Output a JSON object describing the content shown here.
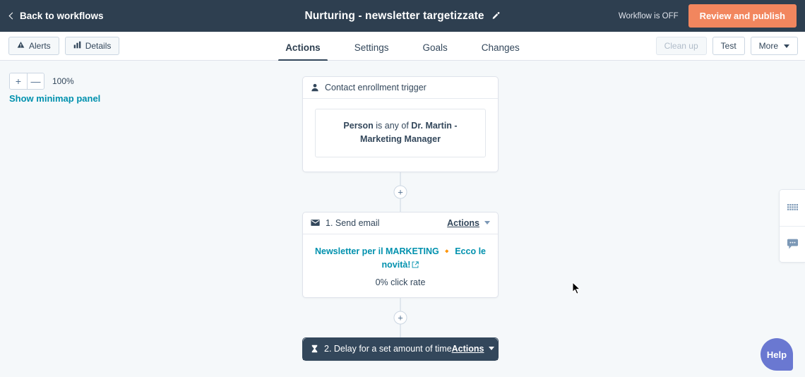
{
  "header": {
    "back_label": "Back to workflows",
    "back_icon": "chevron-left-icon",
    "workflow_title": "Nurturing - newsletter targetizzate",
    "edit_icon": "pencil-icon",
    "workflow_status": "Workflow is OFF",
    "publish_label": "Review and publish",
    "publish_color": "#f2865e",
    "bar_color": "#2e3f50"
  },
  "subnav": {
    "alerts_label": "Alerts",
    "alerts_icon": "warning-triangle-icon",
    "details_label": "Details",
    "details_icon": "bar-chart-icon",
    "tabs": [
      {
        "label": "Actions",
        "active": true
      },
      {
        "label": "Settings",
        "active": false
      },
      {
        "label": "Goals",
        "active": false
      },
      {
        "label": "Changes",
        "active": false
      }
    ],
    "cleanup_label": "Clean up",
    "cleanup_disabled": true,
    "test_label": "Test",
    "more_label": "More"
  },
  "canvas": {
    "zoom_in_label": "+",
    "zoom_out_label": "—",
    "zoom_level": "100%",
    "minimap_link": "Show minimap panel",
    "link_color": "#0091ae"
  },
  "flow": {
    "trigger": {
      "icon": "contact-person-icon",
      "title": "Contact enrollment trigger",
      "filter_prefix": "Person",
      "filter_operator": " is any of ",
      "filter_value": "Dr. Martin - Marketing Manager"
    },
    "email_step": {
      "icon": "envelope-icon",
      "title": "1. Send email",
      "actions_label": "Actions",
      "subject": "Newsletter per il MARKETING 🔸 Ecco le novità!",
      "external_link_icon": "external-link-icon",
      "click_rate": "0% click rate"
    },
    "delay_step": {
      "icon": "hourglass-icon",
      "title": "2. Delay for a set amount of time",
      "actions_label": "Actions",
      "selected": true
    },
    "add_step_icon": "plus-icon"
  },
  "right_rail": {
    "grid_icon": "grid-dots-icon",
    "chat_icon": "chat-bubble-icon"
  },
  "help": {
    "label": "Help",
    "color": "#6a78d1"
  }
}
